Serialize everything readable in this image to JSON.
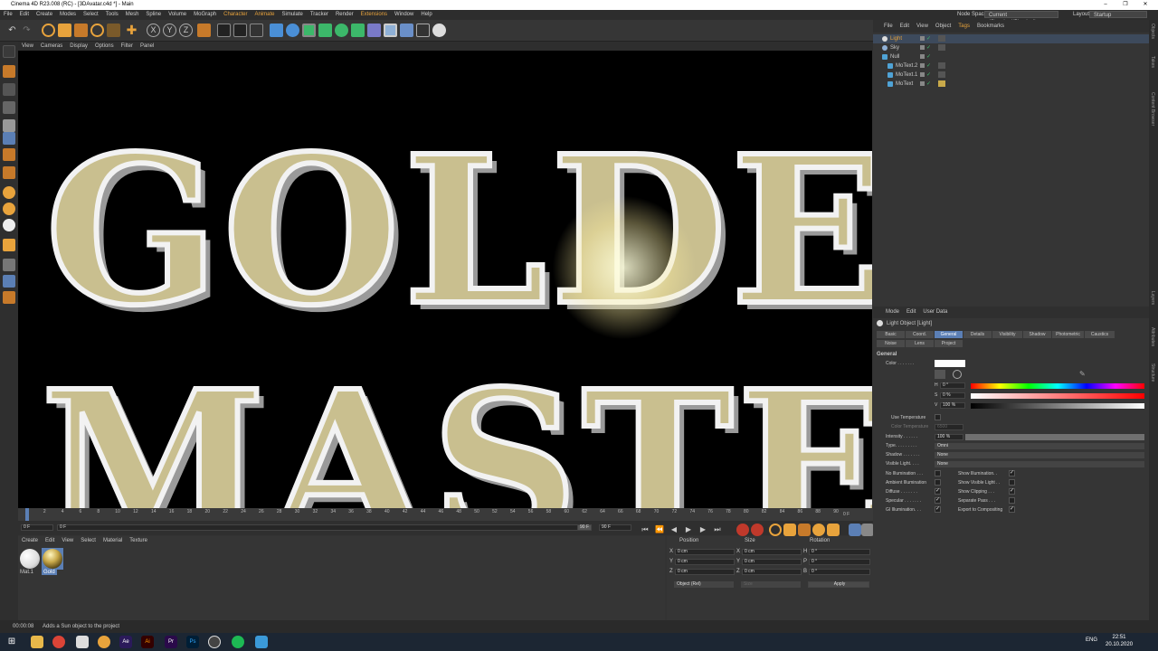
{
  "title_bar": {
    "title": "Cinema 4D R23.008 (RC) - [3DAvatar.c4d *] - Main",
    "min": "–",
    "max": "❐",
    "close": "✕"
  },
  "menu": [
    "File",
    "Edit",
    "Create",
    "Modes",
    "Select",
    "Tools",
    "Mesh",
    "Spline",
    "Volume",
    "MoGraph",
    "Character",
    "Animate",
    "Simulate",
    "Tracker",
    "Render",
    "Extensions",
    "Window",
    "Help"
  ],
  "node_space": {
    "label": "Node Space:",
    "value": "Current (Standard/Physical)"
  },
  "layout": {
    "label": "Layout:",
    "value": "Startup"
  },
  "viewport_menu": [
    "View",
    "Cameras",
    "Display",
    "Options",
    "Filter",
    "Panel"
  ],
  "viewport_text": {
    "line1": "GOLDE",
    "line2": "MASTE"
  },
  "timeline": {
    "ticks": [
      "0",
      "2",
      "4",
      "6",
      "8",
      "10",
      "12",
      "14",
      "16",
      "18",
      "20",
      "22",
      "24",
      "26",
      "28",
      "30",
      "32",
      "34",
      "36",
      "38",
      "40",
      "42",
      "44",
      "46",
      "48",
      "50",
      "52",
      "54",
      "56",
      "58",
      "60",
      "62",
      "64",
      "66",
      "68",
      "70",
      "72",
      "74",
      "76",
      "78",
      "80",
      "82",
      "84",
      "86",
      "88",
      "90"
    ],
    "current_frame": "0 F",
    "start": "0 F",
    "min": "0 F",
    "max": "90 F",
    "end": "90 F"
  },
  "material_manager": {
    "menu": [
      "Create",
      "Edit",
      "View",
      "Select",
      "Material",
      "Texture"
    ],
    "materials": [
      {
        "name": "Mat.1"
      },
      {
        "name": "Gold"
      }
    ]
  },
  "coordinates": {
    "headers": [
      "Position",
      "Size",
      "Rotation"
    ],
    "rows": [
      {
        "axis": "X",
        "pos": "0 cm",
        "size_axis": "X",
        "size": "0 cm",
        "rot_axis": "H",
        "rot": "0 °"
      },
      {
        "axis": "Y",
        "pos": "0 cm",
        "size_axis": "Y",
        "size": "0 cm",
        "rot_axis": "P",
        "rot": "0 °"
      },
      {
        "axis": "Z",
        "pos": "0 cm",
        "size_axis": "Z",
        "size": "0 cm",
        "rot_axis": "B",
        "rot": "0 °"
      }
    ],
    "mode": "Object (Rel)",
    "size_mode": "Size",
    "apply": "Apply"
  },
  "object_manager": {
    "menu": [
      "File",
      "Edit",
      "View",
      "Object",
      "Tags",
      "Bookmarks"
    ],
    "objects": [
      {
        "name": "Light",
        "indent": 0
      },
      {
        "name": "Sky",
        "indent": 0
      },
      {
        "name": "Null",
        "indent": 0
      },
      {
        "name": "MoText.2",
        "indent": 1
      },
      {
        "name": "MoText.1",
        "indent": 1
      },
      {
        "name": "MoText",
        "indent": 1
      }
    ]
  },
  "attributes": {
    "menu": [
      "Mode",
      "Edit",
      "User Data"
    ],
    "object_title": "Light Object [Light]",
    "tabs_row1": [
      "Basic",
      "Coord.",
      "General",
      "Details",
      "Visibility",
      "Shadow",
      "Photometric",
      "Caustics"
    ],
    "tabs_row2": [
      "Noise",
      "Lens",
      "Project"
    ],
    "active_tab": "General",
    "section": "General",
    "color_label": "Color . . . . . . .",
    "hsv": [
      {
        "k": "H",
        "v": "0 °"
      },
      {
        "k": "S",
        "v": "0 %"
      },
      {
        "k": "V",
        "v": "100 %"
      }
    ],
    "use_temperature": "Use Temperature",
    "color_temperature": {
      "label": "Color Temperature",
      "value": "6500"
    },
    "intensity": {
      "label": "Intensity . . . . . .",
      "value": "100 %",
      "level": 1.0
    },
    "type": {
      "label": "Type. . . . . . . . .",
      "value": "Omni"
    },
    "shadow": {
      "label": "Shadow . . . . . . .",
      "value": "None"
    },
    "visible_light": {
      "label": "Visible Light. . . .",
      "value": "None"
    },
    "checks_left": [
      {
        "label": "No Illumination . . .",
        "on": false
      },
      {
        "label": "Ambient Illumination",
        "on": false
      },
      {
        "label": "Diffuse . . . . . . .",
        "on": true
      },
      {
        "label": "Specular . . . . . . .",
        "on": true
      },
      {
        "label": "GI Illumination. . .",
        "on": true
      }
    ],
    "checks_right": [
      {
        "label": "Show Illumination. .",
        "on": true
      },
      {
        "label": "Show Visible Light . .",
        "on": false
      },
      {
        "label": "Show Clipping . . .",
        "on": true
      },
      {
        "label": "Separate Pass . . .",
        "on": false
      },
      {
        "label": "Export to Compositing",
        "on": true
      }
    ]
  },
  "right_strip": [
    "Objects",
    "Takes",
    "Content Browser",
    "Layers",
    "Attributes",
    "Structure"
  ],
  "status": {
    "time": "00:00:08",
    "message": "Adds a Sun object to the project"
  },
  "taskbar": {
    "clock": "22:51",
    "date": "20.10.2020",
    "lang": "ENG"
  },
  "colors": {
    "accent": "#5b7fb5",
    "orange": "#e8a33c",
    "gold": "#c9bf8f"
  }
}
